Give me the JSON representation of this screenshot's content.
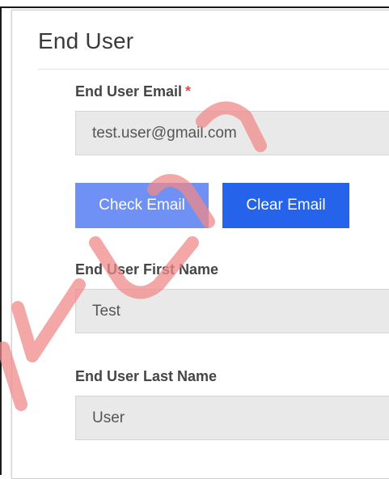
{
  "section": {
    "title": "End User"
  },
  "fields": {
    "email": {
      "label": "End User Email",
      "required_marker": "*",
      "value": "test.user@gmail.com"
    },
    "first_name": {
      "label": "End User First Name",
      "value": "Test"
    },
    "last_name": {
      "label": "End User Last Name",
      "value": "User"
    }
  },
  "buttons": {
    "check_email": "Check Email",
    "clear_email": "Clear Email"
  },
  "colors": {
    "check_email_bg": "#6f90f4",
    "clear_email_bg": "#2463ea",
    "required_marker": "#d9534f",
    "watermark": "#f08a8a"
  }
}
